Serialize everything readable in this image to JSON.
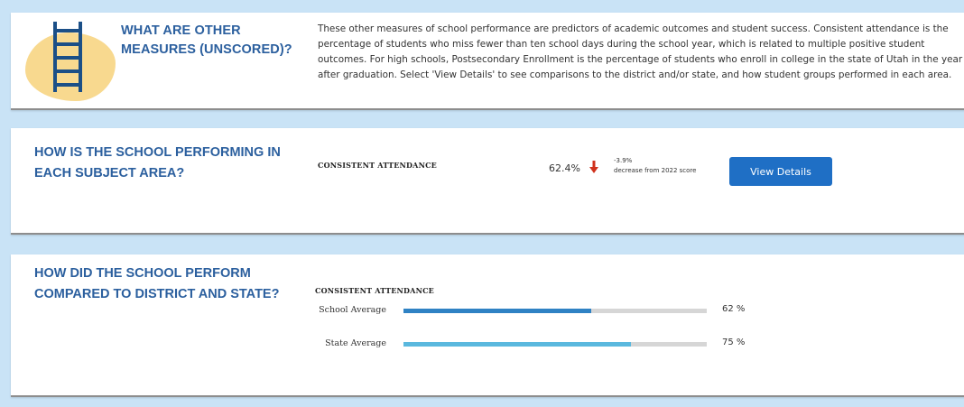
{
  "intro": {
    "heading": "WHAT ARE OTHER MEASURES (UNSCORED)?",
    "icon": "ladder-icon",
    "text": "These other measures of school performance are predictors of academic outcomes and student success. Consistent attendance is the percentage of students who miss fewer than ten school days during the school year, which is related to multiple positive student outcomes. For high schools, Postsecondary Enrollment is the percentage of students who enroll in college in the state of Utah in the year after graduation. Select 'View Details' to see comparisons to the district and/or state, and how student groups performed in each area."
  },
  "subject": {
    "heading": "HOW IS THE SCHOOL PERFORMING IN EACH SUBJECT AREA?",
    "measure_label": "CONSISTENT ATTENDANCE",
    "score": "62.4%",
    "change_value": "-3.9%",
    "change_text": "decrease from 2022 score",
    "button_label": "View Details"
  },
  "compare": {
    "heading": "HOW DID THE SCHOOL PERFORM COMPARED TO DISTRICT AND STATE?",
    "measure_label": "CONSISTENT ATTENDANCE",
    "bars": [
      {
        "label": "School Average",
        "value": 62,
        "value_text": "62 %"
      },
      {
        "label": "State Average",
        "value": 75,
        "value_text": "75 %"
      }
    ]
  },
  "colors": {
    "heading": "#2b5f9e",
    "button": "#1f6fc5",
    "bar_school": "#2f82c4",
    "bar_state": "#5ab8de",
    "bar_track": "#d6d6d6",
    "arrow_down": "#d0311c",
    "blob": "#f8d98f",
    "background": "#c9e3f6"
  }
}
